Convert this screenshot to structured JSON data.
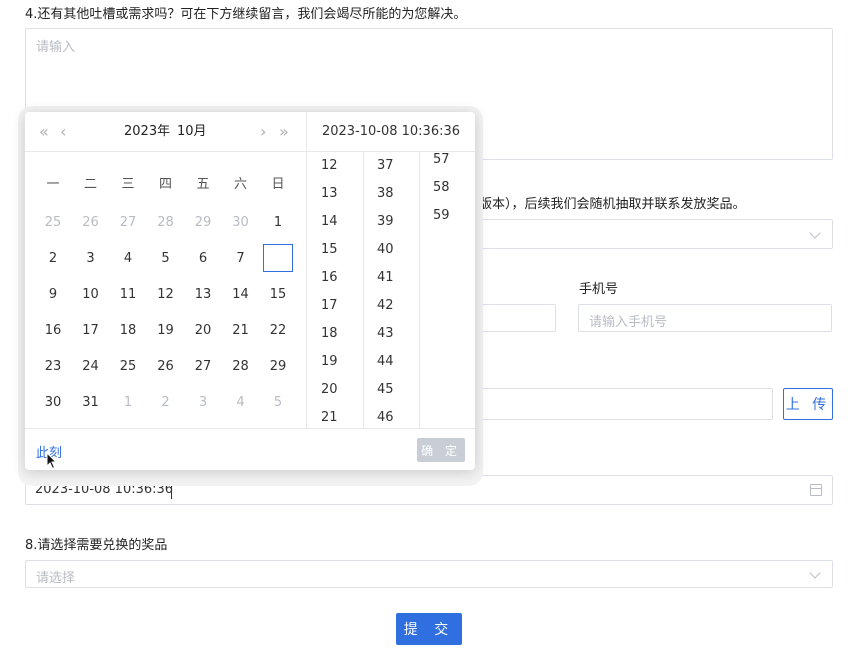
{
  "q4": {
    "title": "4.还有其他吐槽或需求吗？可在下方继续留言，我们会竭尽所能的为您解决。",
    "placeholder": "请输入"
  },
  "q5": {
    "title_partial": "版本），后续我们会随机抽取并联系发放奖品。"
  },
  "phone": {
    "label": "手机号",
    "placeholder": "请输入手机号"
  },
  "upload": {
    "label": "上 传"
  },
  "datetime": {
    "value": "2023-10-08 10:36:36"
  },
  "q8": {
    "title": "8.请选择需要兑换的奖品",
    "placeholder": "请选择"
  },
  "submit": {
    "label": "提 交"
  },
  "picker": {
    "nav": {
      "prev_year": "«",
      "prev_month": "‹",
      "next_month": "›",
      "next_year": "»"
    },
    "year_label": "2023年",
    "month_label": "10月",
    "selected_text": "2023-10-08 10:36:36",
    "weekdays": [
      "一",
      "二",
      "三",
      "四",
      "五",
      "六",
      "日"
    ],
    "weeks": [
      [
        {
          "d": "25",
          "dim": true
        },
        {
          "d": "26",
          "dim": true
        },
        {
          "d": "27",
          "dim": true
        },
        {
          "d": "28",
          "dim": true
        },
        {
          "d": "29",
          "dim": true
        },
        {
          "d": "30",
          "dim": true
        },
        {
          "d": "1",
          "dim": false
        }
      ],
      [
        {
          "d": "2",
          "dim": false
        },
        {
          "d": "3",
          "dim": false
        },
        {
          "d": "4",
          "dim": false
        },
        {
          "d": "5",
          "dim": false
        },
        {
          "d": "6",
          "dim": false
        },
        {
          "d": "7",
          "dim": false
        },
        {
          "d": "",
          "dim": false,
          "today": true
        }
      ],
      [
        {
          "d": "9",
          "dim": false
        },
        {
          "d": "10",
          "dim": false
        },
        {
          "d": "11",
          "dim": false
        },
        {
          "d": "12",
          "dim": false
        },
        {
          "d": "13",
          "dim": false
        },
        {
          "d": "14",
          "dim": false
        },
        {
          "d": "15",
          "dim": false
        }
      ],
      [
        {
          "d": "16",
          "dim": false
        },
        {
          "d": "17",
          "dim": false
        },
        {
          "d": "18",
          "dim": false
        },
        {
          "d": "19",
          "dim": false
        },
        {
          "d": "20",
          "dim": false
        },
        {
          "d": "21",
          "dim": false
        },
        {
          "d": "22",
          "dim": false
        }
      ],
      [
        {
          "d": "23",
          "dim": false
        },
        {
          "d": "24",
          "dim": false
        },
        {
          "d": "25",
          "dim": false
        },
        {
          "d": "26",
          "dim": false
        },
        {
          "d": "27",
          "dim": false
        },
        {
          "d": "28",
          "dim": false
        },
        {
          "d": "29",
          "dim": false
        }
      ],
      [
        {
          "d": "30",
          "dim": false
        },
        {
          "d": "31",
          "dim": false
        },
        {
          "d": "1",
          "dim": true
        },
        {
          "d": "2",
          "dim": true
        },
        {
          "d": "3",
          "dim": true
        },
        {
          "d": "4",
          "dim": true
        },
        {
          "d": "5",
          "dim": true
        }
      ]
    ],
    "hours": [
      "12",
      "13",
      "14",
      "15",
      "16",
      "17",
      "18",
      "19",
      "20",
      "21"
    ],
    "minutes": [
      "37",
      "38",
      "39",
      "40",
      "41",
      "42",
      "43",
      "44",
      "45",
      "46"
    ],
    "seconds": [
      "57",
      "58",
      "59"
    ],
    "now_label": "此刻",
    "ok_label": "确 定"
  },
  "colors": {
    "accent": "#2f6fe0",
    "border": "#dcdfe6",
    "placeholder": "#b8bcc4"
  }
}
